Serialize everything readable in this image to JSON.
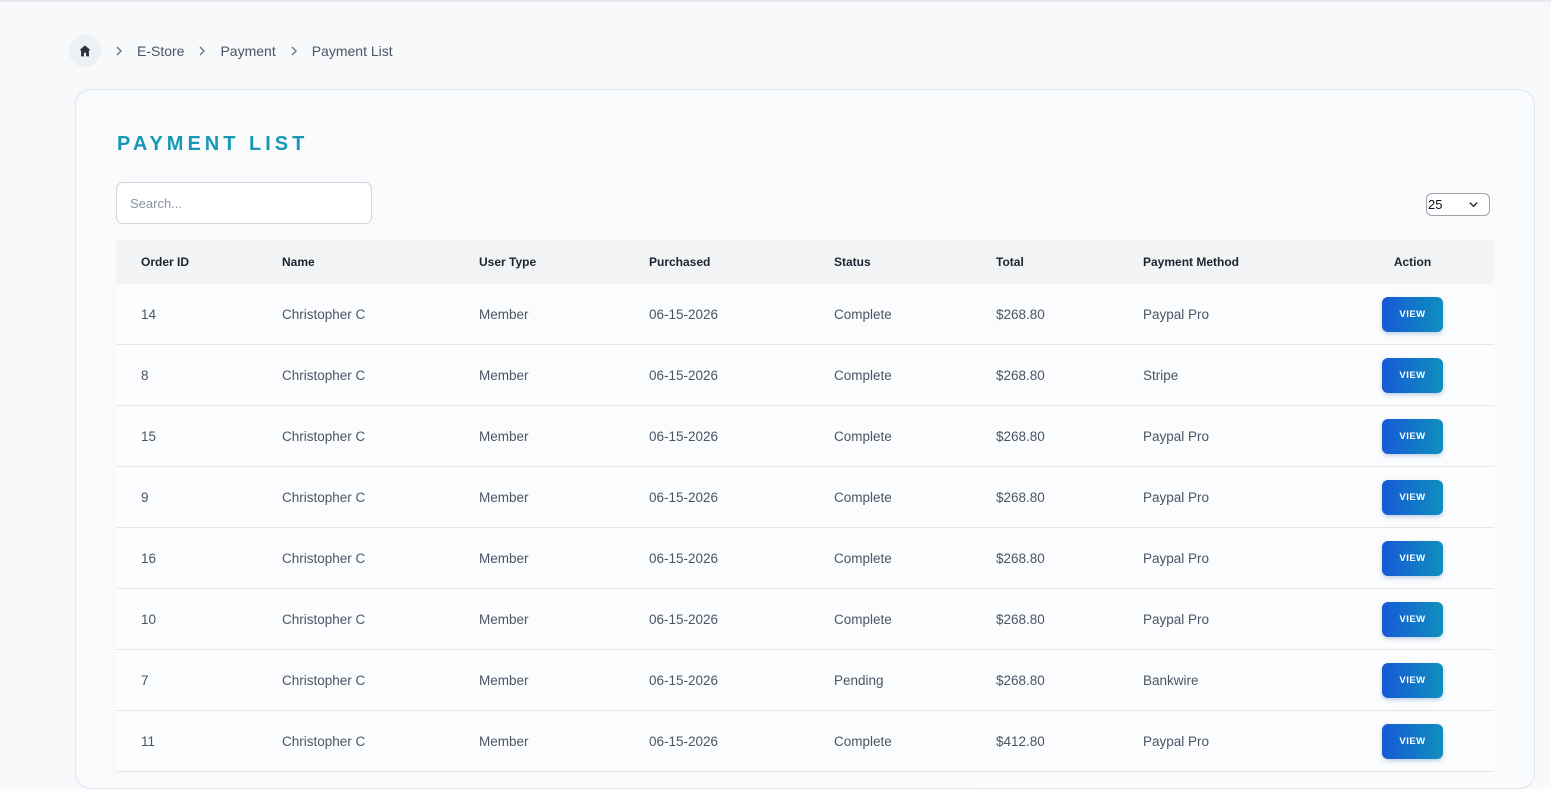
{
  "breadcrumb": {
    "items": [
      "E-Store",
      "Payment",
      "Payment List"
    ]
  },
  "card": {
    "title": "PAYMENT LIST",
    "search_placeholder": "Search...",
    "per_page": "25"
  },
  "table": {
    "headers": [
      "Order ID",
      "Name",
      "User Type",
      "Purchased",
      "Status",
      "Total",
      "Payment Method",
      "Action"
    ],
    "rows": [
      {
        "id": "14",
        "name": "Christopher C",
        "type": "Member",
        "purchased": "06-15-2026",
        "status": "Complete",
        "total": "$268.80",
        "method": "Paypal Pro",
        "action": "VIEW"
      },
      {
        "id": "8",
        "name": "Christopher C",
        "type": "Member",
        "purchased": "06-15-2026",
        "status": "Complete",
        "total": "$268.80",
        "method": "Stripe",
        "action": "VIEW"
      },
      {
        "id": "15",
        "name": "Christopher C",
        "type": "Member",
        "purchased": "06-15-2026",
        "status": "Complete",
        "total": "$268.80",
        "method": "Paypal Pro",
        "action": "VIEW"
      },
      {
        "id": "9",
        "name": "Christopher C",
        "type": "Member",
        "purchased": "06-15-2026",
        "status": "Complete",
        "total": "$268.80",
        "method": "Paypal Pro",
        "action": "VIEW"
      },
      {
        "id": "16",
        "name": "Christopher C",
        "type": "Member",
        "purchased": "06-15-2026",
        "status": "Complete",
        "total": "$268.80",
        "method": "Paypal Pro",
        "action": "VIEW"
      },
      {
        "id": "10",
        "name": "Christopher C",
        "type": "Member",
        "purchased": "06-15-2026",
        "status": "Complete",
        "total": "$268.80",
        "method": "Paypal Pro",
        "action": "VIEW"
      },
      {
        "id": "7",
        "name": "Christopher C",
        "type": "Member",
        "purchased": "06-15-2026",
        "status": "Pending",
        "total": "$268.80",
        "method": "Bankwire",
        "action": "VIEW"
      },
      {
        "id": "11",
        "name": "Christopher C",
        "type": "Member",
        "purchased": "06-15-2026",
        "status": "Complete",
        "total": "$412.80",
        "method": "Paypal Pro",
        "action": "VIEW"
      }
    ]
  },
  "icons": {
    "home": "home-icon",
    "separator": "chevron-right-icon",
    "dropdown": "chevron-down-icon"
  },
  "colors": {
    "title": "#1898b5",
    "button_start": "#1659d6",
    "button_end": "#0f8fbd"
  }
}
